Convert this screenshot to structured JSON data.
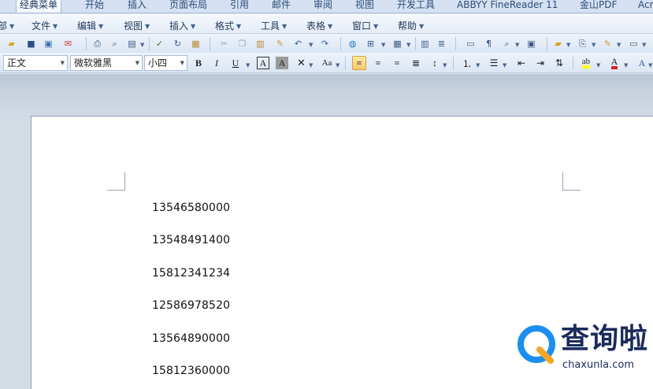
{
  "ribbon_tabs": [
    "经典菜单",
    "开始",
    "插入",
    "页面布局",
    "引用",
    "邮件",
    "审阅",
    "视图",
    "开发工具",
    "ABBYY FineReader 11",
    "金山PDF",
    "Acr"
  ],
  "menu_items": [
    "部",
    "文件",
    "编辑",
    "视图",
    "插入",
    "格式",
    "工具",
    "表格",
    "窗口",
    "帮助"
  ],
  "format_bar": {
    "style_value": "正文",
    "font_value": "微软雅黑",
    "size_value": "小四",
    "bold": "B",
    "italic": "I",
    "underline": "U",
    "char_border": "A",
    "char_shading": "A",
    "change_case": "Aa"
  },
  "document": {
    "lines": [
      "13546580000",
      "13548491400",
      "15812341234",
      "12586978520",
      "13564890000",
      "15812360000"
    ]
  },
  "watermark": {
    "text": "查询啦",
    "url": "chaxunla.com"
  },
  "colors": {
    "highlight": "#ffff00",
    "font_color": "#e02020",
    "watermark_blue": "#1c8ef0",
    "watermark_orange": "#f5a623"
  }
}
